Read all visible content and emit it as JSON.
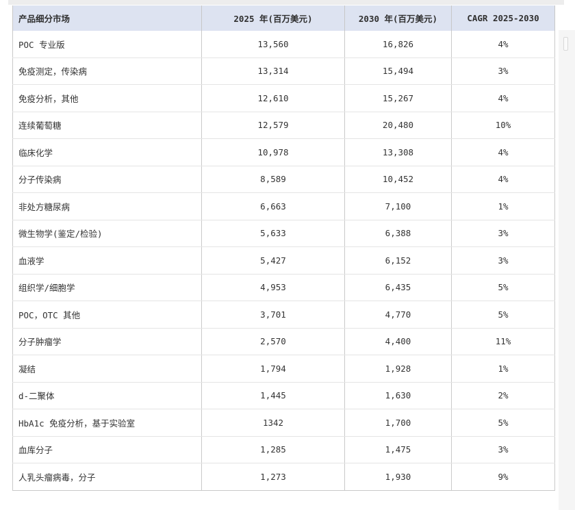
{
  "table": {
    "headers": [
      "产品细分市场",
      "2025 年(百万美元)",
      "2030 年(百万美元)",
      "CAGR 2025-2030"
    ],
    "rows": [
      [
        "POC 专业版",
        "13,560",
        "16,826",
        "4%"
      ],
      [
        "免疫测定，传染病",
        "13,314",
        "15,494",
        "3%"
      ],
      [
        "免疫分析，其他",
        "12,610",
        "15,267",
        "4%"
      ],
      [
        "连续葡萄糖",
        "12,579",
        "20,480",
        "10%"
      ],
      [
        "临床化学",
        "10,978",
        "13,308",
        "4%"
      ],
      [
        "分子传染病",
        "8,589",
        "10,452",
        "4%"
      ],
      [
        "非处方糖尿病",
        "6,663",
        "7,100",
        "1%"
      ],
      [
        "微生物学(鉴定/检验)",
        "5,633",
        "6,388",
        "3%"
      ],
      [
        "血液学",
        "5,427",
        "6,152",
        "3%"
      ],
      [
        "组织学/细胞学",
        "4,953",
        "6,435",
        "5%"
      ],
      [
        "POC，OTC 其他",
        "3,701",
        "4,770",
        "5%"
      ],
      [
        "分子肿瘤学",
        "2,570",
        "4,400",
        "11%"
      ],
      [
        "凝结",
        "1,794",
        "1,928",
        "1%"
      ],
      [
        "d-二聚体",
        "1,445",
        "1,630",
        "2%"
      ],
      [
        "HbA1c 免疫分析，基于实验室",
        "1342",
        "1,700",
        "5%"
      ],
      [
        "血库分子",
        "1,285",
        "1,475",
        "3%"
      ],
      [
        "人乳头瘤病毒，分子",
        "1,273",
        "1,930",
        "9%"
      ]
    ]
  },
  "colors": {
    "header_background": "#dde3f1",
    "border": "#c9c9c9"
  }
}
